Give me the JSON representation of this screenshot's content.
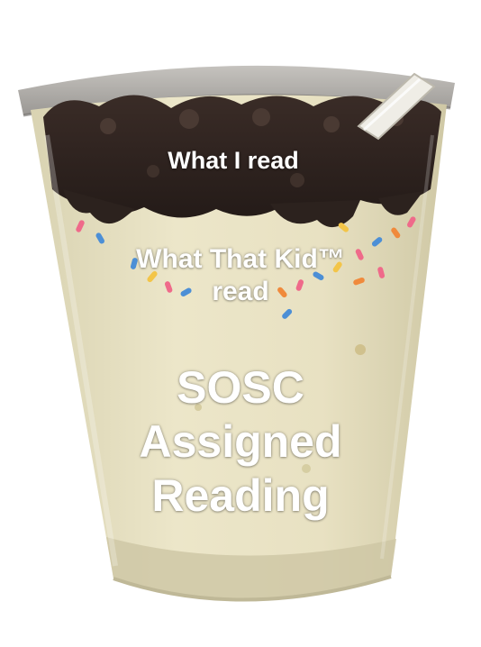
{
  "captions": {
    "top": "What I read",
    "middle_line1": "What That Kid™",
    "middle_line2": "read",
    "bottom_line1": "SOSC",
    "bottom_line2": "Assigned",
    "bottom_line3": "Reading"
  },
  "icons": {
    "main_image": "layered-dessert-cup",
    "straw": "straw"
  },
  "colors": {
    "cookie_crumble": "#2f2420",
    "cream": "#e8e2c4",
    "cup_plastic": "#d9d6d0",
    "caption_text": "#ffffff",
    "sprinkle_pink": "#ef6a8a",
    "sprinkle_blue": "#4c8fd6",
    "sprinkle_yellow": "#f3c548",
    "sprinkle_orange": "#f08a3c"
  }
}
